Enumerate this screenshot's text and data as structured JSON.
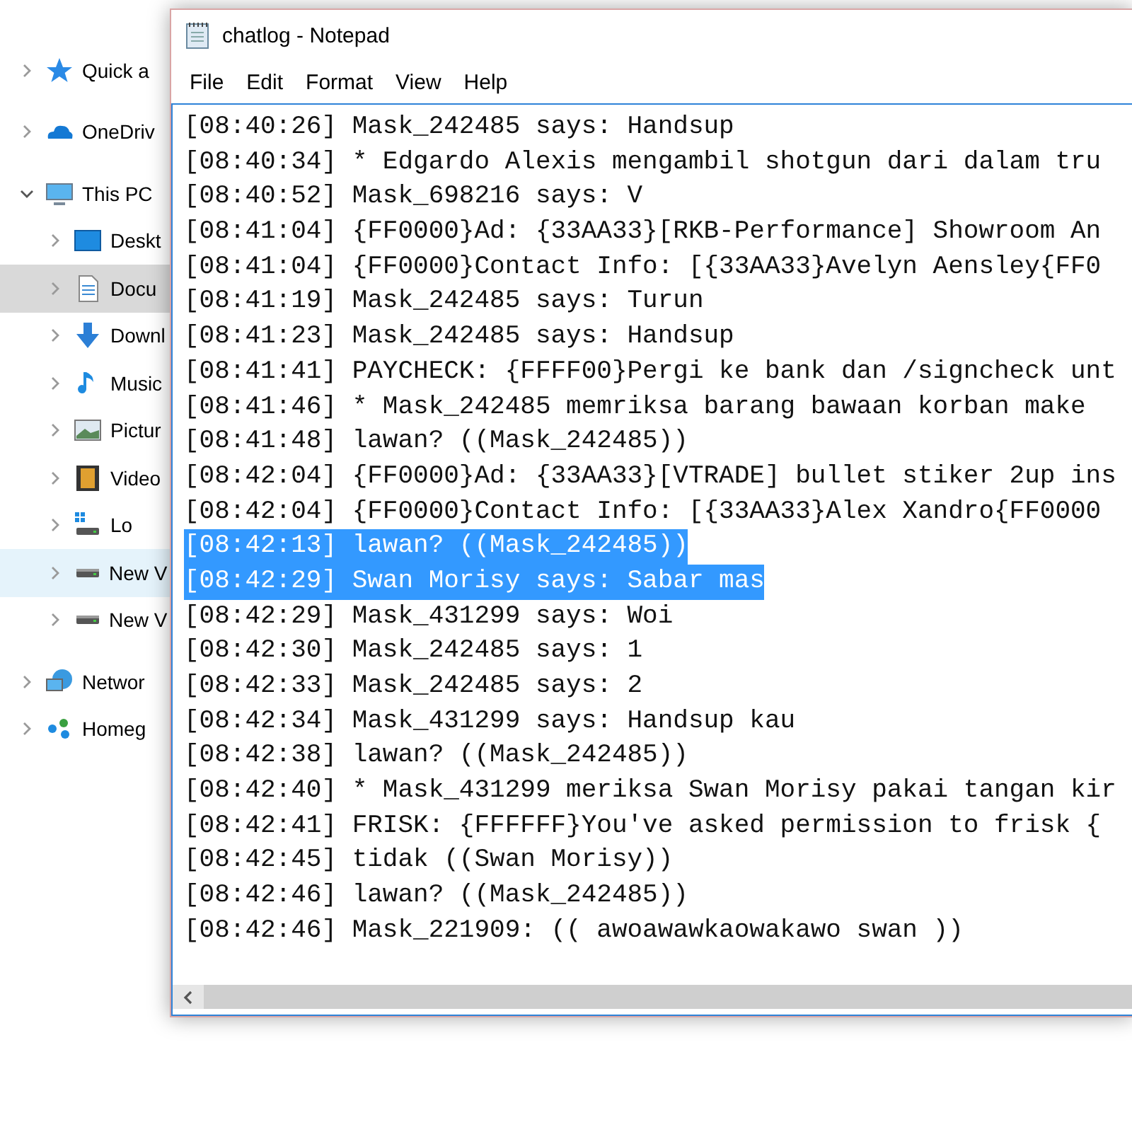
{
  "sidebar": {
    "items": [
      {
        "label": "Quick a",
        "expanded": false,
        "selected": false,
        "hovered": false
      },
      {
        "label": "OneDriv",
        "expanded": false,
        "selected": false,
        "hovered": false
      },
      {
        "label": "This PC",
        "expanded": true,
        "selected": false,
        "hovered": false,
        "children": [
          {
            "label": "Deskt",
            "expanded": false,
            "selected": false,
            "hovered": false
          },
          {
            "label": "Docu",
            "expanded": false,
            "selected": true,
            "hovered": false
          },
          {
            "label": "Downl",
            "expanded": false,
            "selected": false,
            "hovered": false
          },
          {
            "label": "Music",
            "expanded": false,
            "selected": false,
            "hovered": false
          },
          {
            "label": "Pictur",
            "expanded": false,
            "selected": false,
            "hovered": false
          },
          {
            "label": "Video",
            "expanded": false,
            "selected": false,
            "hovered": false
          },
          {
            "label": "Lo",
            "expanded": false,
            "selected": false,
            "hovered": false
          },
          {
            "label": "New V",
            "expanded": false,
            "selected": false,
            "hovered": true
          },
          {
            "label": "New V",
            "expanded": false,
            "selected": false,
            "hovered": false
          }
        ]
      },
      {
        "label": "Networ",
        "expanded": false,
        "selected": false,
        "hovered": false
      },
      {
        "label": "Homeg",
        "expanded": false,
        "selected": false,
        "hovered": false
      }
    ]
  },
  "notepad": {
    "title": "chatlog - Notepad",
    "menu": [
      "File",
      "Edit",
      "Format",
      "View",
      "Help"
    ],
    "lines": [
      {
        "text": "[08:40:26] Mask_242485 says: Handsup",
        "selected": false
      },
      {
        "text": "[08:40:34] * Edgardo Alexis mengambil shotgun dari dalam tru",
        "selected": false
      },
      {
        "text": "[08:40:52] Mask_698216 says: V",
        "selected": false
      },
      {
        "text": "[08:41:04] {FF0000}Ad: {33AA33}[RKB-Performance] Showroom An",
        "selected": false
      },
      {
        "text": "[08:41:04] {FF0000}Contact Info: [{33AA33}Avelyn Aensley{FF0",
        "selected": false
      },
      {
        "text": "[08:41:19] Mask_242485 says: Turun",
        "selected": false
      },
      {
        "text": "[08:41:23] Mask_242485 says: Handsup",
        "selected": false
      },
      {
        "text": "[08:41:41] PAYCHECK: {FFFF00}Pergi ke bank dan /signcheck unt",
        "selected": false
      },
      {
        "text": "[08:41:46] * Mask_242485 memriksa barang bawaan korban make",
        "selected": false
      },
      {
        "text": "[08:41:48] lawan? ((Mask_242485))",
        "selected": false
      },
      {
        "text": "[08:42:04] {FF0000}Ad: {33AA33}[VTRADE] bullet stiker 2up ins",
        "selected": false
      },
      {
        "text": "[08:42:04] {FF0000}Contact Info: [{33AA33}Alex Xandro{FF0000",
        "selected": false
      },
      {
        "text": "[08:42:13] lawan? ((Mask_242485))",
        "selected": true
      },
      {
        "text": "[08:42:29] Swan Morisy says: Sabar mas",
        "selected": true
      },
      {
        "text": "[08:42:29] Mask_431299 says: Woi",
        "selected": false
      },
      {
        "text": "[08:42:30] Mask_242485 says: 1",
        "selected": false
      },
      {
        "text": "[08:42:33] Mask_242485 says: 2",
        "selected": false
      },
      {
        "text": "[08:42:34] Mask_431299 says: Handsup kau",
        "selected": false
      },
      {
        "text": "[08:42:38] lawan? ((Mask_242485))",
        "selected": false
      },
      {
        "text": "[08:42:40] * Mask_431299 meriksa Swan Morisy pakai tangan kir",
        "selected": false
      },
      {
        "text": "[08:42:41] FRISK: {FFFFFF}You've asked permission to frisk {",
        "selected": false
      },
      {
        "text": "[08:42:45] tidak ((Swan Morisy))",
        "selected": false
      },
      {
        "text": "[08:42:46] lawan? ((Mask_242485))",
        "selected": false
      },
      {
        "text": "[08:42:46] Mask_221909: (( awoawawkaowakawo swan ))",
        "selected": false
      }
    ]
  }
}
